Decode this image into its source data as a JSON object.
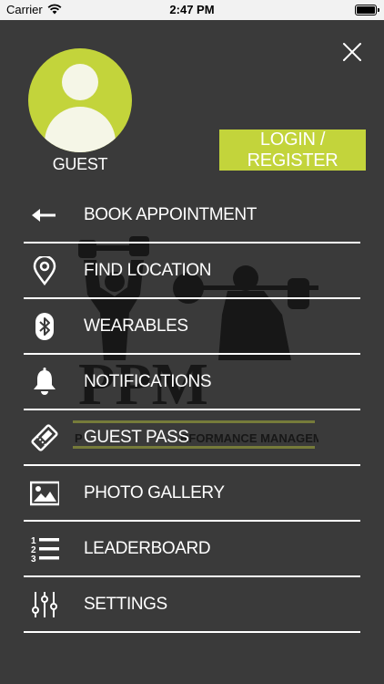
{
  "status_bar": {
    "carrier": "Carrier",
    "time": "2:47 PM"
  },
  "profile": {
    "name": "GUEST"
  },
  "login_button": {
    "label": "LOGIN / REGISTER"
  },
  "watermark": {
    "initials": "PPM",
    "tagline_left": "P",
    "tagline_right": "RFORMANCE MANAGEMENT"
  },
  "menu": {
    "items": [
      {
        "label": "BOOK APPOINTMENT",
        "icon": "arrow-left-icon"
      },
      {
        "label": "FIND LOCATION",
        "icon": "location-pin-icon"
      },
      {
        "label": "WEARABLES",
        "icon": "bluetooth-icon"
      },
      {
        "label": "NOTIFICATIONS",
        "icon": "bell-icon"
      },
      {
        "label": "GUEST PASS",
        "icon": "ticket-icon"
      },
      {
        "label": "PHOTO GALLERY",
        "icon": "image-icon"
      },
      {
        "label": "LEADERBOARD",
        "icon": "numbered-list-icon"
      },
      {
        "label": "SETTINGS",
        "icon": "sliders-icon"
      }
    ]
  },
  "colors": {
    "background": "#3a3a3a",
    "accent": "#c3d43b",
    "avatar_fg": "#f5f6e7"
  }
}
